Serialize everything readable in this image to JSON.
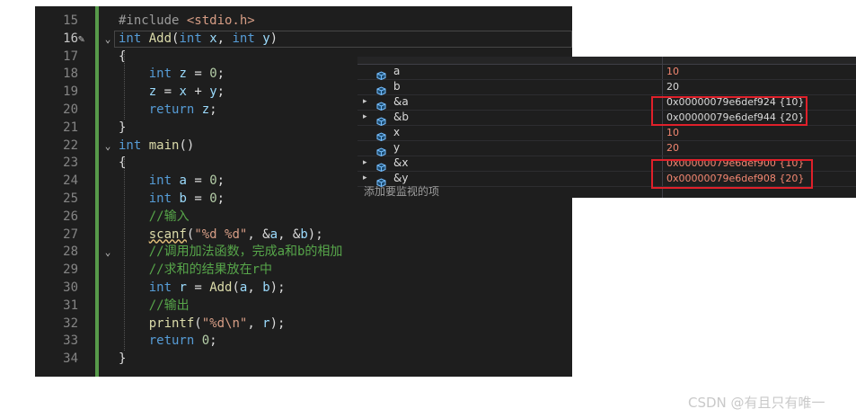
{
  "editor": {
    "lines": [
      {
        "n": "15",
        "parts": [
          [
            "pp",
            "#include "
          ],
          [
            "inc",
            "<stdio.h>"
          ]
        ]
      },
      {
        "n": "16",
        "parts": [
          [
            "kw",
            "int"
          ],
          [
            "t",
            " "
          ],
          [
            "fn",
            "Add"
          ],
          [
            "t",
            "("
          ],
          [
            "kw",
            "int"
          ],
          [
            "t",
            " "
          ],
          [
            "var",
            "x"
          ],
          [
            "t",
            ", "
          ],
          [
            "kw",
            "int"
          ],
          [
            "t",
            " "
          ],
          [
            "var",
            "y"
          ],
          [
            "t",
            ")"
          ]
        ]
      },
      {
        "n": "17",
        "parts": [
          [
            "t",
            "{"
          ]
        ]
      },
      {
        "n": "18",
        "parts": [
          [
            "t",
            "    "
          ],
          [
            "kw",
            "int"
          ],
          [
            "t",
            " "
          ],
          [
            "var",
            "z"
          ],
          [
            "t",
            " = "
          ],
          [
            "num",
            "0"
          ],
          [
            "t",
            ";"
          ]
        ]
      },
      {
        "n": "19",
        "parts": [
          [
            "t",
            "    "
          ],
          [
            "var",
            "z"
          ],
          [
            "t",
            " = "
          ],
          [
            "var",
            "x"
          ],
          [
            "t",
            " + "
          ],
          [
            "var",
            "y"
          ],
          [
            "t",
            ";"
          ]
        ]
      },
      {
        "n": "20",
        "parts": [
          [
            "t",
            "    "
          ],
          [
            "kw",
            "return"
          ],
          [
            "t",
            " "
          ],
          [
            "var",
            "z"
          ],
          [
            "t",
            ";"
          ]
        ]
      },
      {
        "n": "21",
        "parts": [
          [
            "t",
            "}"
          ]
        ]
      },
      {
        "n": "22",
        "parts": [
          [
            "kw",
            "int"
          ],
          [
            "t",
            " "
          ],
          [
            "fn",
            "main"
          ],
          [
            "t",
            "()"
          ]
        ]
      },
      {
        "n": "23",
        "parts": [
          [
            "t",
            "{"
          ]
        ]
      },
      {
        "n": "24",
        "parts": [
          [
            "t",
            "    "
          ],
          [
            "kw",
            "int"
          ],
          [
            "t",
            " "
          ],
          [
            "var",
            "a"
          ],
          [
            "t",
            " = "
          ],
          [
            "num",
            "0"
          ],
          [
            "t",
            ";"
          ]
        ]
      },
      {
        "n": "25",
        "parts": [
          [
            "t",
            "    "
          ],
          [
            "kw",
            "int"
          ],
          [
            "t",
            " "
          ],
          [
            "var",
            "b"
          ],
          [
            "t",
            " = "
          ],
          [
            "num",
            "0"
          ],
          [
            "t",
            ";"
          ]
        ]
      },
      {
        "n": "26",
        "parts": [
          [
            "t",
            "    "
          ],
          [
            "cm",
            "//输入"
          ]
        ]
      },
      {
        "n": "27",
        "parts": [
          [
            "t",
            "    "
          ],
          [
            "fnsq",
            "scanf"
          ],
          [
            "t",
            "("
          ],
          [
            "str",
            "\"%d %d\""
          ],
          [
            "t",
            ", &"
          ],
          [
            "var",
            "a"
          ],
          [
            "t",
            ", &"
          ],
          [
            "var",
            "b"
          ],
          [
            "t",
            ");"
          ]
        ]
      },
      {
        "n": "28",
        "parts": [
          [
            "t",
            "    "
          ],
          [
            "cm",
            "//调用加法函数，完成a和b的相加"
          ]
        ]
      },
      {
        "n": "29",
        "parts": [
          [
            "t",
            "    "
          ],
          [
            "cm",
            "//求和的结果放在r中"
          ]
        ]
      },
      {
        "n": "30",
        "parts": [
          [
            "t",
            "    "
          ],
          [
            "kw",
            "int"
          ],
          [
            "t",
            " "
          ],
          [
            "var",
            "r"
          ],
          [
            "t",
            " = "
          ],
          [
            "fn",
            "Add"
          ],
          [
            "t",
            "("
          ],
          [
            "var",
            "a"
          ],
          [
            "t",
            ", "
          ],
          [
            "var",
            "b"
          ],
          [
            "t",
            ");"
          ]
        ]
      },
      {
        "n": "31",
        "parts": [
          [
            "t",
            "    "
          ],
          [
            "cm",
            "//输出"
          ]
        ]
      },
      {
        "n": "32",
        "parts": [
          [
            "t",
            "    "
          ],
          [
            "fn",
            "printf"
          ],
          [
            "t",
            "("
          ],
          [
            "str",
            "\"%d\\n\""
          ],
          [
            "t",
            ", "
          ],
          [
            "var",
            "r"
          ],
          [
            "t",
            ");"
          ]
        ]
      },
      {
        "n": "33",
        "parts": [
          [
            "t",
            "    "
          ],
          [
            "kw",
            "return"
          ],
          [
            "t",
            " "
          ],
          [
            "num",
            "0"
          ],
          [
            "t",
            ";"
          ]
        ]
      },
      {
        "n": "34",
        "parts": [
          [
            "t",
            "}"
          ]
        ]
      }
    ]
  },
  "watch": {
    "rows": [
      {
        "expand": "",
        "name": "a",
        "value": "10",
        "changed": true
      },
      {
        "expand": "",
        "name": "b",
        "value": "20",
        "changed": false
      },
      {
        "expand": "▸",
        "name": "&a",
        "value": "0x00000079e6def924 {10}",
        "changed": false
      },
      {
        "expand": "▸",
        "name": "&b",
        "value": "0x00000079e6def944 {20}",
        "changed": false
      },
      {
        "expand": "",
        "name": "x",
        "value": "10",
        "changed": true
      },
      {
        "expand": "",
        "name": "y",
        "value": "20",
        "changed": true
      },
      {
        "expand": "▸",
        "name": "&x",
        "value": "0x00000079e6def900 {10}",
        "changed": true
      },
      {
        "expand": "▸",
        "name": "&y",
        "value": "0x00000079e6def908 {20}",
        "changed": true
      }
    ],
    "add_watch_label": "添加要监视的项"
  },
  "watermark": "CSDN @有且只有唯一",
  "colors": {
    "highlight_box": "#e0202a",
    "changed_value": "#f48771",
    "change_bar": "#579a4a"
  }
}
